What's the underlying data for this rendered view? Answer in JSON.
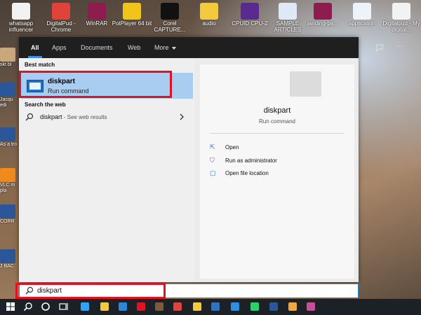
{
  "desktop": {
    "top_icons": [
      {
        "label": "whatsapp influencer",
        "icon": "document-icon",
        "color": "#f2f2f2"
      },
      {
        "label": "DigitalPud - Chrome",
        "icon": "chrome-icon",
        "color": "#e0433a"
      },
      {
        "label": "WinRAR",
        "icon": "winrar-icon",
        "color": "#8c1d4e"
      },
      {
        "label": "PotPlayer 64 bit",
        "icon": "potplayer-icon",
        "color": "#f0c419"
      },
      {
        "label": "Corel CAPTURE...",
        "icon": "corel-capture-icon",
        "color": "#111111"
      },
      {
        "label": "audio",
        "icon": "folder-icon",
        "color": "#f3c93d"
      },
      {
        "label": "CPUID CPU-Z",
        "icon": "cpuz-icon",
        "color": "#5b2a8e"
      },
      {
        "label": "SAMPLE ARTICLES",
        "icon": "word-doc-icon",
        "color": "#dfe8f5"
      },
      {
        "label": "landing-pa...",
        "icon": "winrar-icon",
        "color": "#8c1d4e"
      },
      {
        "label": "application",
        "icon": "document-icon",
        "color": "#eef3fa"
      },
      {
        "label": "Digitalpud - My digital...",
        "icon": "pdf-icon",
        "color": "#f2f2f2"
      }
    ],
    "left_icons": [
      {
        "label": "skt bl",
        "icon": "folder-icon",
        "color": "#c9a77a"
      },
      {
        "label": "Jacqu edi",
        "icon": "word-icon",
        "color": "#2b579a"
      },
      {
        "label": "As a tro",
        "icon": "word-icon",
        "color": "#2b579a"
      },
      {
        "label": "VLC m pla",
        "icon": "vlc-icon",
        "color": "#f08a1c"
      },
      {
        "label": "CORR",
        "icon": "word-icon",
        "color": "#2b579a"
      },
      {
        "label": "J BAC",
        "icon": "word-icon",
        "color": "#2b579a"
      }
    ]
  },
  "search_panel": {
    "tabs": [
      {
        "label": "All",
        "active": true
      },
      {
        "label": "Apps",
        "active": false
      },
      {
        "label": "Documents",
        "active": false
      },
      {
        "label": "Web",
        "active": false
      },
      {
        "label": "More",
        "active": false,
        "has_dropdown": true
      }
    ],
    "feedback_icon": "feedback-icon",
    "more_options_glyph": "···",
    "best_match": {
      "heading": "Best match",
      "name": "diskpart",
      "type": "Run command"
    },
    "web": {
      "heading": "Search the web",
      "query": "diskpart",
      "suffix": " - See web results"
    },
    "preview": {
      "name": "diskpart",
      "type": "Run command",
      "actions": [
        {
          "label": "Open",
          "icon": "open-icon",
          "glyph": "⇱"
        },
        {
          "label": "Run as administrator",
          "icon": "shield-icon",
          "glyph": "⛉"
        },
        {
          "label": "Open file location",
          "icon": "file-location-icon",
          "glyph": "▢"
        }
      ]
    }
  },
  "search_box": {
    "value": "diskpart",
    "placeholder": ""
  },
  "highlight_color": "#e2131f",
  "taskbar": {
    "items": [
      {
        "name": "windows-start-icon",
        "color": "#ffffff"
      },
      {
        "name": "search-icon",
        "color": "#ffffff"
      },
      {
        "name": "cortana-icon",
        "color": "#ffffff"
      },
      {
        "name": "task-view-icon",
        "color": "#ffffff"
      },
      {
        "name": "photoshop-icon",
        "color": "#2fa3f7"
      },
      {
        "name": "file-explorer-icon",
        "color": "#f3c93d"
      },
      {
        "name": "mail-icon",
        "color": "#2b88d8"
      },
      {
        "name": "media-player-icon",
        "color": "#e2131f"
      },
      {
        "name": "store-icon",
        "color": "#7a5c3a"
      },
      {
        "name": "chrome-icon",
        "color": "#e0433a"
      },
      {
        "name": "folder-icon",
        "color": "#f3c93d"
      },
      {
        "name": "app-icon",
        "color": "#2f74c0"
      },
      {
        "name": "vscode-icon",
        "color": "#2f8fe0"
      },
      {
        "name": "whatsapp-icon",
        "color": "#25d366"
      },
      {
        "name": "word-icon",
        "color": "#2b579a"
      },
      {
        "name": "paint-icon",
        "color": "#f2a93b"
      },
      {
        "name": "app-icon-2",
        "color": "#c74c9a"
      }
    ]
  }
}
